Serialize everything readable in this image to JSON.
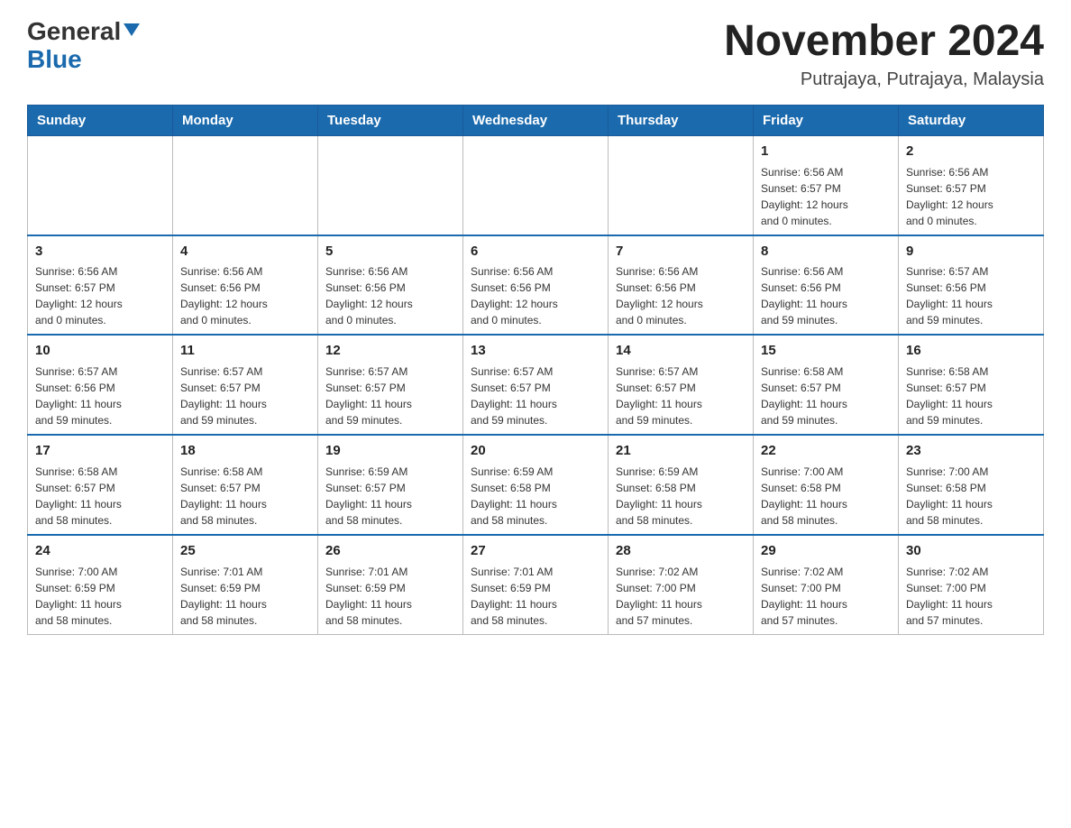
{
  "header": {
    "logo_general": "General",
    "logo_blue": "Blue",
    "month_title": "November 2024",
    "location": "Putrajaya, Putrajaya, Malaysia"
  },
  "days_of_week": [
    "Sunday",
    "Monday",
    "Tuesday",
    "Wednesday",
    "Thursday",
    "Friday",
    "Saturday"
  ],
  "weeks": [
    {
      "days": [
        {
          "number": "",
          "info": ""
        },
        {
          "number": "",
          "info": ""
        },
        {
          "number": "",
          "info": ""
        },
        {
          "number": "",
          "info": ""
        },
        {
          "number": "",
          "info": ""
        },
        {
          "number": "1",
          "info": "Sunrise: 6:56 AM\nSunset: 6:57 PM\nDaylight: 12 hours\nand 0 minutes."
        },
        {
          "number": "2",
          "info": "Sunrise: 6:56 AM\nSunset: 6:57 PM\nDaylight: 12 hours\nand 0 minutes."
        }
      ]
    },
    {
      "days": [
        {
          "number": "3",
          "info": "Sunrise: 6:56 AM\nSunset: 6:57 PM\nDaylight: 12 hours\nand 0 minutes."
        },
        {
          "number": "4",
          "info": "Sunrise: 6:56 AM\nSunset: 6:56 PM\nDaylight: 12 hours\nand 0 minutes."
        },
        {
          "number": "5",
          "info": "Sunrise: 6:56 AM\nSunset: 6:56 PM\nDaylight: 12 hours\nand 0 minutes."
        },
        {
          "number": "6",
          "info": "Sunrise: 6:56 AM\nSunset: 6:56 PM\nDaylight: 12 hours\nand 0 minutes."
        },
        {
          "number": "7",
          "info": "Sunrise: 6:56 AM\nSunset: 6:56 PM\nDaylight: 12 hours\nand 0 minutes."
        },
        {
          "number": "8",
          "info": "Sunrise: 6:56 AM\nSunset: 6:56 PM\nDaylight: 11 hours\nand 59 minutes."
        },
        {
          "number": "9",
          "info": "Sunrise: 6:57 AM\nSunset: 6:56 PM\nDaylight: 11 hours\nand 59 minutes."
        }
      ]
    },
    {
      "days": [
        {
          "number": "10",
          "info": "Sunrise: 6:57 AM\nSunset: 6:56 PM\nDaylight: 11 hours\nand 59 minutes."
        },
        {
          "number": "11",
          "info": "Sunrise: 6:57 AM\nSunset: 6:57 PM\nDaylight: 11 hours\nand 59 minutes."
        },
        {
          "number": "12",
          "info": "Sunrise: 6:57 AM\nSunset: 6:57 PM\nDaylight: 11 hours\nand 59 minutes."
        },
        {
          "number": "13",
          "info": "Sunrise: 6:57 AM\nSunset: 6:57 PM\nDaylight: 11 hours\nand 59 minutes."
        },
        {
          "number": "14",
          "info": "Sunrise: 6:57 AM\nSunset: 6:57 PM\nDaylight: 11 hours\nand 59 minutes."
        },
        {
          "number": "15",
          "info": "Sunrise: 6:58 AM\nSunset: 6:57 PM\nDaylight: 11 hours\nand 59 minutes."
        },
        {
          "number": "16",
          "info": "Sunrise: 6:58 AM\nSunset: 6:57 PM\nDaylight: 11 hours\nand 59 minutes."
        }
      ]
    },
    {
      "days": [
        {
          "number": "17",
          "info": "Sunrise: 6:58 AM\nSunset: 6:57 PM\nDaylight: 11 hours\nand 58 minutes."
        },
        {
          "number": "18",
          "info": "Sunrise: 6:58 AM\nSunset: 6:57 PM\nDaylight: 11 hours\nand 58 minutes."
        },
        {
          "number": "19",
          "info": "Sunrise: 6:59 AM\nSunset: 6:57 PM\nDaylight: 11 hours\nand 58 minutes."
        },
        {
          "number": "20",
          "info": "Sunrise: 6:59 AM\nSunset: 6:58 PM\nDaylight: 11 hours\nand 58 minutes."
        },
        {
          "number": "21",
          "info": "Sunrise: 6:59 AM\nSunset: 6:58 PM\nDaylight: 11 hours\nand 58 minutes."
        },
        {
          "number": "22",
          "info": "Sunrise: 7:00 AM\nSunset: 6:58 PM\nDaylight: 11 hours\nand 58 minutes."
        },
        {
          "number": "23",
          "info": "Sunrise: 7:00 AM\nSunset: 6:58 PM\nDaylight: 11 hours\nand 58 minutes."
        }
      ]
    },
    {
      "days": [
        {
          "number": "24",
          "info": "Sunrise: 7:00 AM\nSunset: 6:59 PM\nDaylight: 11 hours\nand 58 minutes."
        },
        {
          "number": "25",
          "info": "Sunrise: 7:01 AM\nSunset: 6:59 PM\nDaylight: 11 hours\nand 58 minutes."
        },
        {
          "number": "26",
          "info": "Sunrise: 7:01 AM\nSunset: 6:59 PM\nDaylight: 11 hours\nand 58 minutes."
        },
        {
          "number": "27",
          "info": "Sunrise: 7:01 AM\nSunset: 6:59 PM\nDaylight: 11 hours\nand 58 minutes."
        },
        {
          "number": "28",
          "info": "Sunrise: 7:02 AM\nSunset: 7:00 PM\nDaylight: 11 hours\nand 57 minutes."
        },
        {
          "number": "29",
          "info": "Sunrise: 7:02 AM\nSunset: 7:00 PM\nDaylight: 11 hours\nand 57 minutes."
        },
        {
          "number": "30",
          "info": "Sunrise: 7:02 AM\nSunset: 7:00 PM\nDaylight: 11 hours\nand 57 minutes."
        }
      ]
    }
  ]
}
